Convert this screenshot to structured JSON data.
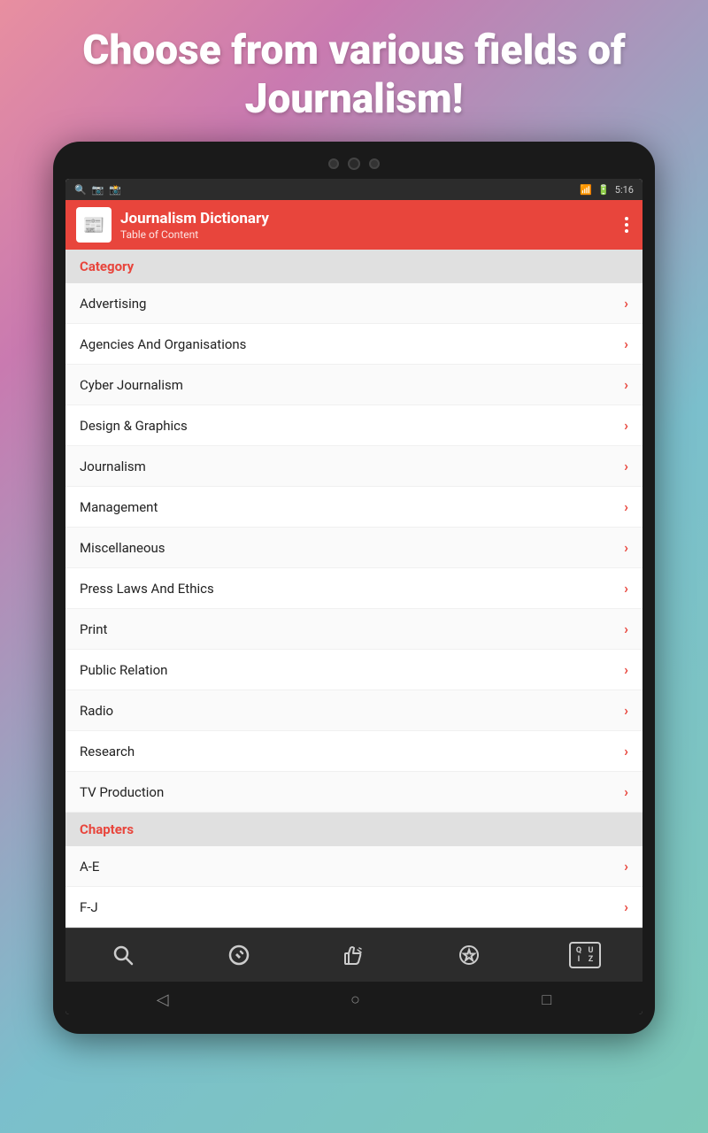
{
  "hero": {
    "text": "Choose from various fields of Journalism!"
  },
  "statusBar": {
    "time": "5:16",
    "icons": [
      "🔍",
      "📷",
      "📸"
    ]
  },
  "appBar": {
    "title": "Journalism Dictionary",
    "subtitle": "Table of Content",
    "appIcon": "📰"
  },
  "categories": {
    "sectionLabel": "Category",
    "items": [
      {
        "label": "Advertising"
      },
      {
        "label": "Agencies And Organisations"
      },
      {
        "label": "Cyber Journalism"
      },
      {
        "label": "Design & Graphics"
      },
      {
        "label": "Journalism"
      },
      {
        "label": "Management"
      },
      {
        "label": "Miscellaneous"
      },
      {
        "label": "Press Laws And Ethics"
      },
      {
        "label": "Print"
      },
      {
        "label": "Public Relation"
      },
      {
        "label": "Radio"
      },
      {
        "label": "Research"
      },
      {
        "label": "TV Production"
      }
    ]
  },
  "chapters": {
    "sectionLabel": "Chapters",
    "items": [
      {
        "label": "A-E"
      },
      {
        "label": "F-J"
      }
    ]
  },
  "bottomNav": {
    "items": [
      {
        "name": "search",
        "icon": "🔍"
      },
      {
        "name": "edit",
        "icon": "✏"
      },
      {
        "name": "feedback",
        "icon": "👍"
      },
      {
        "name": "favorite",
        "icon": "⭐"
      }
    ],
    "quiz": {
      "cells": [
        "QU",
        "IZ"
      ]
    }
  },
  "androidNav": {
    "back": "◁",
    "home": "○",
    "recent": "□"
  }
}
